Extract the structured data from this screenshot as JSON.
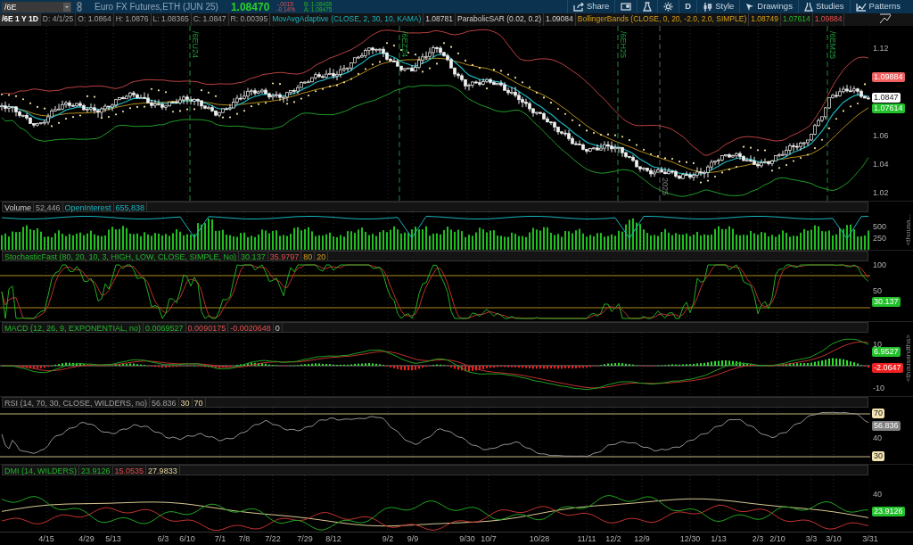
{
  "toolbar": {
    "symbol": "/6E",
    "description": "Euro FX Futures,ETH (JUN 25)",
    "last": "1.08470",
    "change": "-.0015",
    "change_pct": "-0.14%",
    "bid": "B: 1.08465",
    "ask": "A: 1.08475",
    "buttons": [
      {
        "kind": "share",
        "label": "Share"
      },
      {
        "kind": "screen"
      },
      {
        "kind": "flask"
      },
      {
        "kind": "gear"
      },
      {
        "kind": "text",
        "label": "D"
      },
      {
        "kind": "style",
        "label": "Style"
      },
      {
        "kind": "drawings",
        "label": "Drawings"
      },
      {
        "kind": "studies",
        "label": "Studies"
      },
      {
        "kind": "patterns",
        "label": "Patterns"
      }
    ]
  },
  "panes": [
    {
      "kind": "price",
      "header": [
        {
          "text": "/6E 1 Y 1D",
          "kind": "symbol"
        },
        {
          "text": "D: 4/1/25",
          "kind": "field"
        },
        {
          "text": "O: 1.0864",
          "kind": "field"
        },
        {
          "text": "H: 1.0876",
          "kind": "field"
        },
        {
          "text": "L: 1.08365",
          "kind": "field"
        },
        {
          "text": "C: 1.0847",
          "kind": "field"
        },
        {
          "text": "R: 0.00395",
          "kind": "field"
        },
        {
          "text": "MovAvgAdaptive (CLOSE, 2, 30, 10, KAMA)",
          "kind": "kama"
        },
        {
          "text": "1.08781",
          "kind": "light"
        },
        {
          "text": "ParabolicSAR (0.02, 0.2)",
          "kind": "light"
        },
        {
          "text": "1.09084",
          "kind": "light"
        },
        {
          "text": "BollingerBands (CLOSE, 0, 20, -2.0, 2.0, SIMPLE)",
          "kind": "gold"
        },
        {
          "text": "1.08749",
          "kind": "gold"
        },
        {
          "text": "1.07614",
          "kind": "plus"
        },
        {
          "text": "1.09884",
          "kind": "minus"
        }
      ],
      "ticks": [
        "1.12",
        "1.06",
        "1.04",
        "1.02"
      ],
      "badges": [
        {
          "text": "1.09884",
          "color": "#f06060"
        },
        {
          "text": "1.0847",
          "color": "#ffffff"
        },
        {
          "text": "1.07614",
          "color": "#22c02a"
        }
      ],
      "event_labels": [
        "/6EU24",
        "/6EZ24",
        "/6EH25",
        "/6EM25",
        "2025"
      ]
    },
    {
      "kind": "volume",
      "header": [
        {
          "text": "Volume",
          "kind": "light"
        },
        {
          "text": "52,446",
          "kind": "field"
        },
        {
          "text": "OpenInterest",
          "kind": "kama"
        },
        {
          "text": "655,838",
          "kind": "kama"
        }
      ],
      "ticks": [
        "500",
        "250"
      ],
      "side_label": "<thousa..."
    },
    {
      "kind": "stochastic",
      "header": [
        {
          "text": "StochasticFast (80, 20, 10, 3, HIGH, LOW, CLOSE, SIMPLE, No)",
          "kind": "plus"
        },
        {
          "text": "30.137",
          "kind": "plus"
        },
        {
          "text": "35.9797",
          "kind": "minus"
        },
        {
          "text": "80",
          "kind": "gold"
        },
        {
          "text": "20",
          "kind": "gold"
        }
      ],
      "ticks": [
        "100",
        "50"
      ],
      "badges": [
        {
          "text": "30.137",
          "color": "#22c02a"
        }
      ]
    },
    {
      "kind": "macd",
      "header": [
        {
          "text": "MACD (12, 26, 9, EXPONENTIAL, no)",
          "kind": "plus"
        },
        {
          "text": "0.0069527",
          "kind": "plus"
        },
        {
          "text": "0.0090175",
          "kind": "minus"
        },
        {
          "text": "-0.0020648",
          "kind": "minus"
        },
        {
          "text": "0",
          "kind": "light"
        }
      ],
      "ticks": [
        "10",
        "-10"
      ],
      "badges": [
        {
          "text": "6.9527",
          "color": "#22c02a"
        },
        {
          "text": "-2.0647",
          "color": "#ee2020"
        }
      ],
      "side_label": "<thousandths>"
    },
    {
      "kind": "rsi",
      "header": [
        {
          "text": "RSI (14, 70, 30, CLOSE, WILDERS, no)",
          "kind": "field"
        },
        {
          "text": "56.836",
          "kind": "field"
        },
        {
          "text": "30",
          "kind": "tan"
        },
        {
          "text": "70",
          "kind": "tan"
        }
      ],
      "ticks": [
        "40"
      ],
      "badges": [
        {
          "text": "70",
          "color": "#f2e3b0"
        },
        {
          "text": "56.836",
          "color": "#808080"
        },
        {
          "text": "30",
          "color": "#f2e3b0"
        }
      ]
    },
    {
      "kind": "dmi",
      "header": [
        {
          "text": "DMI (14, WILDERS)",
          "kind": "plus"
        },
        {
          "text": "23.9126",
          "kind": "plus"
        },
        {
          "text": "15.0535",
          "kind": "minus"
        },
        {
          "text": "27.9833",
          "kind": "tan"
        }
      ],
      "ticks": [
        "40"
      ],
      "badges": [
        {
          "text": "23.9126",
          "color": "#22c02a"
        }
      ]
    }
  ],
  "dates": [
    "4/15",
    "4/29",
    "5/13",
    "6/3",
    "6/10",
    "7/1",
    "7/8",
    "7/22",
    "7/29",
    "8/12",
    "9/2",
    "9/9",
    "9/30",
    "10/7",
    "10/28",
    "11/11",
    "12/2",
    "12/9",
    "12/30",
    "1/13",
    "2/3",
    "2/10",
    "3/3",
    "3/10",
    "3/31"
  ]
}
